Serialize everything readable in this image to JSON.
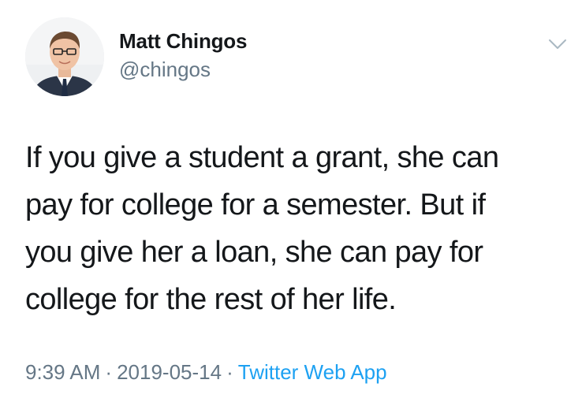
{
  "author": {
    "name": "Matt Chingos",
    "handle": "@chingos"
  },
  "tweet": {
    "lines": [
      "If you give a student a grant, she can",
      "pay for college for a semester. But if",
      "you give her a loan, she can pay for",
      "college for the rest of her life."
    ]
  },
  "meta": {
    "time": "9:39 AM",
    "separator": "·",
    "date": "2019-05-14",
    "source": "Twitter Web App"
  },
  "icons": {
    "menu": "chevron-down-icon"
  },
  "colors": {
    "text": "#14171a",
    "secondary": "#657786",
    "link": "#1da1f2"
  }
}
